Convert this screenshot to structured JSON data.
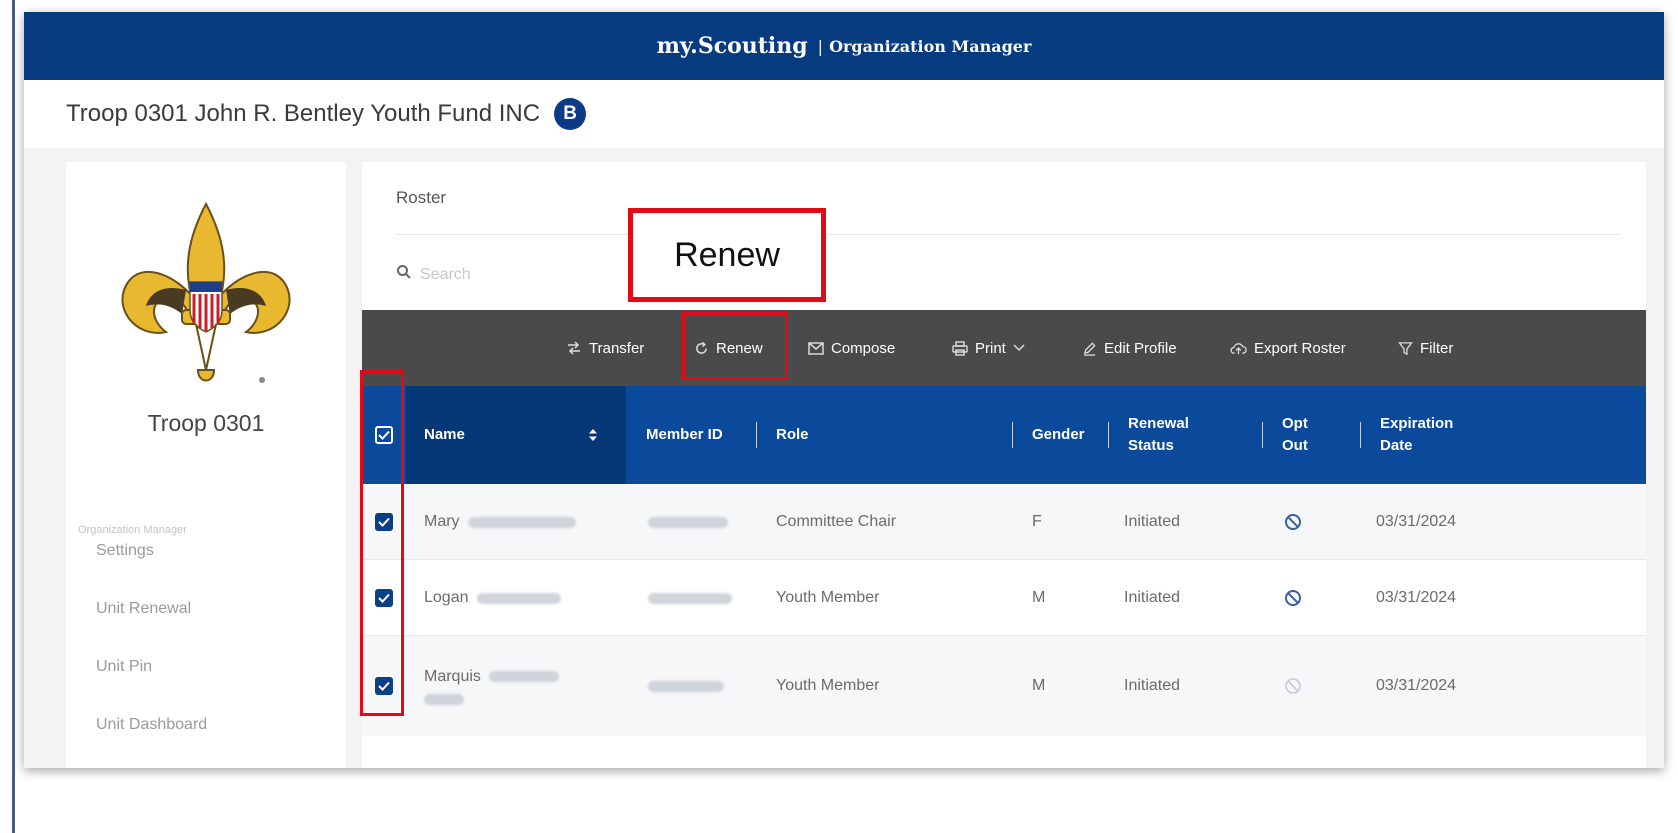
{
  "app": {
    "brand": "my.Scouting",
    "separator": "|",
    "module": "Organization Manager"
  },
  "org": {
    "title": "Troop 0301 John R. Bentley Youth Fund INC",
    "badge": "B"
  },
  "sidebar": {
    "unit_name": "Troop 0301",
    "section_heading": "Organization Manager",
    "items": [
      {
        "label": "Settings"
      },
      {
        "label": "Unit Renewal"
      },
      {
        "label": "Unit Pin"
      },
      {
        "label": "Unit Dashboard"
      }
    ]
  },
  "roster": {
    "title": "Roster",
    "search_placeholder": "Search"
  },
  "toolbar": {
    "transfer": "Transfer",
    "renew": "Renew",
    "compose": "Compose",
    "print": "Print",
    "edit_profile": "Edit Profile",
    "export_roster": "Export Roster",
    "filter": "Filter"
  },
  "table": {
    "columns": {
      "name": "Name",
      "member_id": "Member ID",
      "role": "Role",
      "gender": "Gender",
      "renewal_status_1": "Renewal",
      "renewal_status_2": "Status",
      "opt_out_1": "Opt",
      "opt_out_2": "Out",
      "expiration_1": "Expiration",
      "expiration_2": "Date"
    },
    "rows": [
      {
        "first_name": "Mary",
        "role": "Committee Chair",
        "gender": "F",
        "status": "Initiated",
        "expiration": "03/31/2024",
        "checked": true
      },
      {
        "first_name": "Logan",
        "role": "Youth Member",
        "gender": "M",
        "status": "Initiated",
        "expiration": "03/31/2024",
        "checked": true
      },
      {
        "first_name": "Marquis",
        "role": "Youth Member",
        "gender": "M",
        "status": "Initiated",
        "expiration": "03/31/2024",
        "checked": true
      }
    ]
  },
  "annotation": {
    "callout_text": "Renew"
  },
  "colors": {
    "brand_blue": "#063b80",
    "header_blue": "#0b4a9b",
    "toolbar_gray": "#4a4a4a",
    "highlight_red": "#e20a16"
  }
}
